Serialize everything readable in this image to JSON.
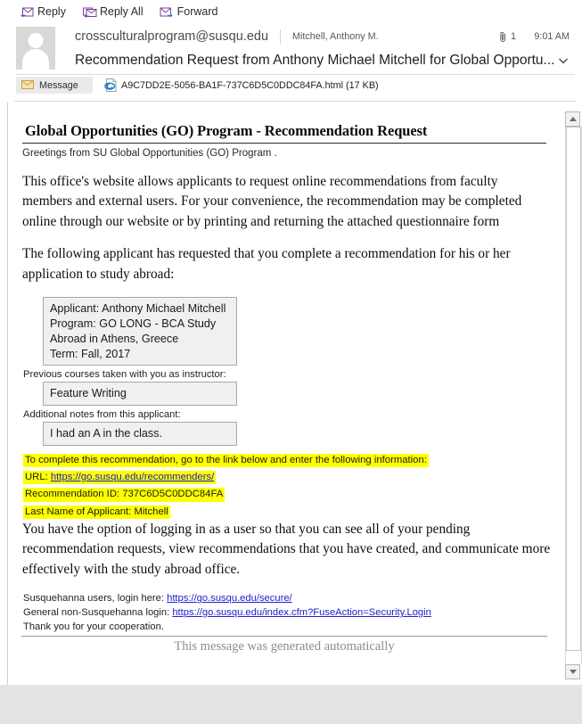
{
  "toolbar": {
    "reply_label": "Reply",
    "reply_all_label": "Reply All",
    "forward_label": "Forward"
  },
  "header": {
    "from": "crossculturalprogram@susqu.edu",
    "to": "Mitchell, Anthony M.",
    "attachment_count": "1",
    "time": "9:01 AM",
    "subject": "Recommendation Request from Anthony Michael Mitchell for Global Opportu..."
  },
  "attachment_bar": {
    "message_tab_label": "Message",
    "attachment_name": "A9C7DD2E-5056-BA1F-737C6D5C0DDC84FA.html (17 KB)"
  },
  "body": {
    "title": "Global Opportunities (GO) Program - Recommendation Request",
    "greeting": "Greetings from SU Global Opportunities (GO) Program .",
    "para1": "This office's website allows applicants to request online recommendations from faculty members and external users. For your convenience, the recommendation may be completed online through our website or by printing and returning the attached questionnaire form",
    "para2": "The following applicant has requested that you complete a recommendation for his or her application to study abroad:",
    "applicant_box": "Applicant: Anthony Michael Mitchell\nProgram: GO LONG - BCA Study Abroad in Athens, Greece\nTerm: Fall, 2017",
    "courses_label": "Previous courses taken with you as instructor:",
    "courses_value": "Feature Writing",
    "notes_label": "Additional notes from this applicant:",
    "notes_value": "I had an A in the class.",
    "highlight": {
      "line1": "To complete this recommendation, go to the link below and enter the following information:",
      "url_prefix": "URL: ",
      "url": "https://go.susqu.edu/recommenders/",
      "rec_id": "Recommendation ID: 737C6D5C0DDC84FA",
      "last_name": "Last Name of Applicant: Mitchell"
    },
    "para3": "You have the option of logging in as a user so that you can see all of your pending recommendation requests, view recommendations that you have created, and communicate more effectively with the study abroad office.",
    "footer": {
      "line1_prefix": "Susquehanna users, login here: ",
      "line1_url": "https://go.susqu.edu/secure/",
      "line2_prefix": "General non-Susquehanna login: ",
      "line2_url": "https://go.susqu.edu/index.cfm?FuseAction=Security.Login",
      "line3": "Thank you for your cooperation."
    },
    "autogen_note": "This message was generated automatically"
  },
  "colors": {
    "highlight": "#ffff00",
    "link": "#2020cc",
    "accent_purple": "#7b3fa0",
    "accent_blue": "#1f6fc4"
  }
}
